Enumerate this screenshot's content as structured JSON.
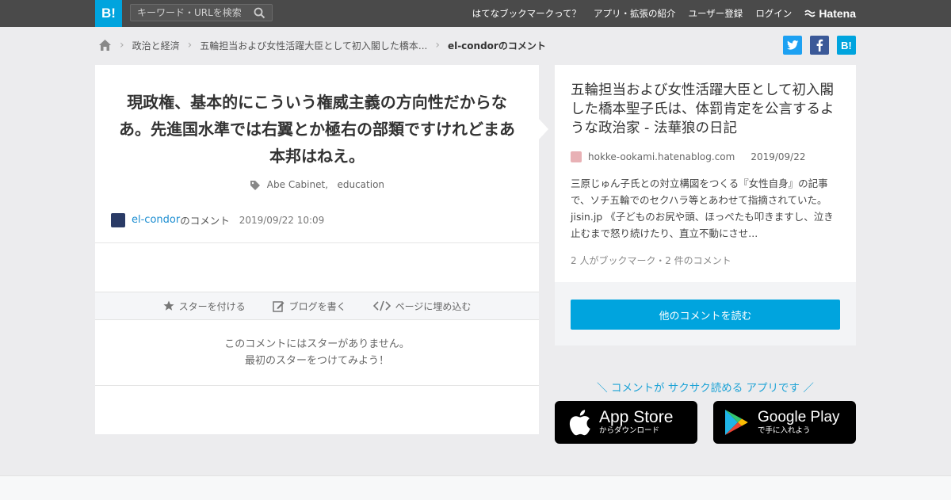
{
  "header": {
    "logo": "B!",
    "search_placeholder": "キーワード・URLを検索",
    "nav": [
      "はてなブックマークって？",
      "アプリ・拡張の紹介",
      "ユーザー登録",
      "ログイン"
    ],
    "brand": "Hatena"
  },
  "breadcrumb": {
    "items": [
      "政治と経済",
      "五輪担当および女性活躍大臣として初入閣した橋本..."
    ],
    "current": "el-condorのコメント"
  },
  "share": {
    "hatena_label": "B!"
  },
  "comment": {
    "text": "現政権、基本的にこういう権威主義の方向性だからなあ。先進国水準では右翼とか極右の部類ですけれどまあ本邦はねえ。",
    "tags": [
      "Abe Cabinet,",
      "education"
    ],
    "user": "el-condor",
    "user_suffix": "のコメント",
    "date": "2019/09/22 10:09",
    "actions": [
      "スターを付ける",
      "ブログを書く",
      "ページに埋め込む"
    ],
    "no_stars_line1": "このコメントにはスターがありません。",
    "no_stars_line2": "最初のスターをつけてみよう！"
  },
  "entry": {
    "title": "五輪担当および女性活躍大臣として初入閣した橋本聖子氏は、体罰肯定を公言するような政治家 - 法華狼の日記",
    "domain": "hokke-ookami.hatenablog.com",
    "date": "2019/09/22",
    "summary": "三原じゅん子氏との対立構図をつくる『女性自身』の記事で、ソチ五輪でのセクハラ等とあわせて指摘されていた。 jisin.jp 《子どものお尻や頭、ほっぺたも叩きますし、泣き止むまで怒り続けたり、直立不動にさせ...",
    "counts": "2 人がブックマーク・2 件のコメント",
    "read_button": "他のコメントを読む"
  },
  "app_promo": {
    "tagline": "＼ コメントが サクサク読める アプリです ／",
    "appstore_name": "App Store",
    "appstore_sub": "からダウンロード",
    "googleplay_name": "Google Play",
    "googleplay_sub": "で手に入れよう"
  },
  "colors": {
    "accent": "#00a4de",
    "topbar": "#4a4a4a",
    "twitter": "#1da1f2",
    "facebook": "#3b5998"
  }
}
